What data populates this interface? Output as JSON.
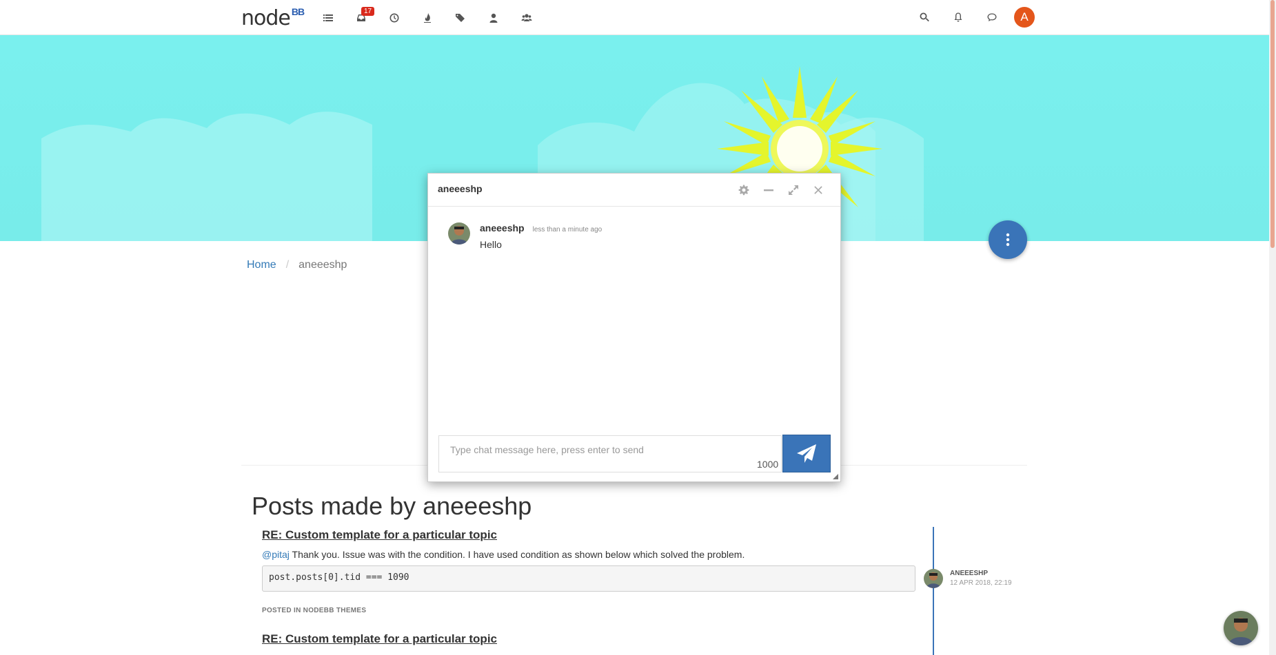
{
  "brand": {
    "name": "node",
    "suffix": "BB"
  },
  "nav": {
    "notification_badge": "17"
  },
  "user": {
    "avatar_letter": "A",
    "username": "aneeeshp"
  },
  "breadcrumb": {
    "home": "Home",
    "sep": "/",
    "current": "aneeeshp"
  },
  "chat": {
    "title": "aneeeshp",
    "message": {
      "user": "aneeeshp",
      "time": "less than a minute ago",
      "text": "Hello"
    },
    "input_placeholder": "Type chat message here, press enter to send",
    "char_count": "1000"
  },
  "posts": {
    "heading": "Posts made by aneeeshp",
    "items": [
      {
        "title": "RE: Custom template for a particular topic",
        "mention": "@pitaj",
        "text": " Thank you. Issue was with the condition. I have used condition as shown below which solved the problem.",
        "code": "post.posts[0].tid === 1090",
        "posted_in": "POSTED IN NODEBB THEMES",
        "author": "ANEEESHP",
        "date": "12 APR 2018, 22:19"
      },
      {
        "title": "RE: Custom template for a particular topic"
      }
    ]
  },
  "colors": {
    "accent": "#3a74b8",
    "cover": "#7af0ee",
    "avatar": "#e4561b",
    "badge": "#d9291c"
  }
}
